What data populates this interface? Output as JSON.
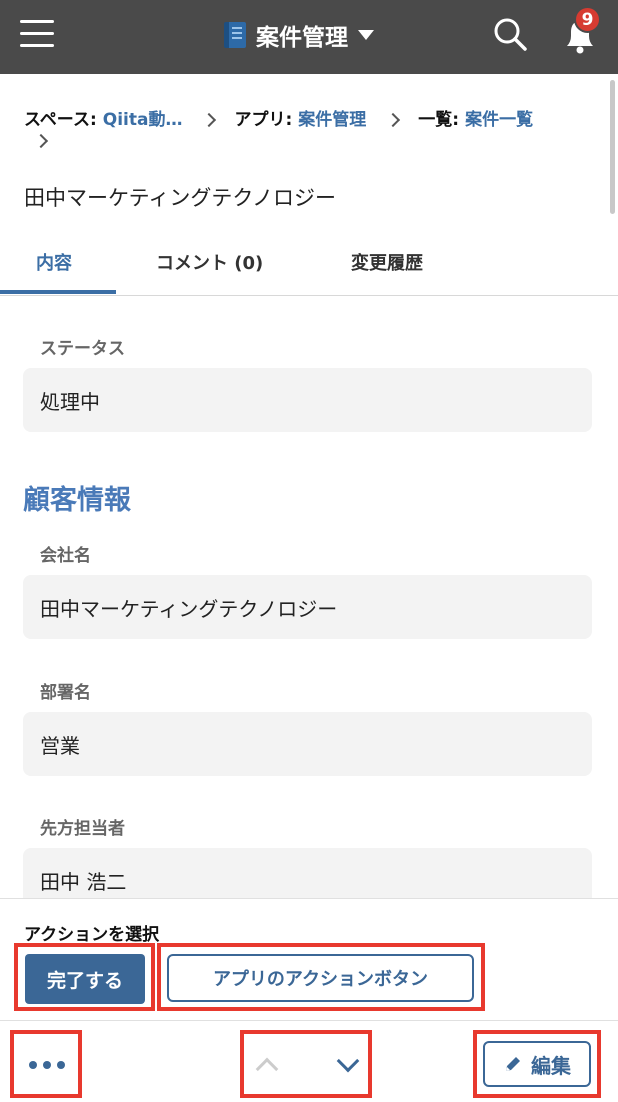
{
  "header": {
    "app_title": "案件管理",
    "notification_count": "9"
  },
  "breadcrumb": {
    "space_label": "スペース:",
    "space_value": "Qiita動…",
    "app_label": "アプリ:",
    "app_value": "案件管理",
    "list_label": "一覧:",
    "list_value": "案件一覧"
  },
  "record": {
    "title": "田中マーケティングテクノロジー"
  },
  "tabs": [
    {
      "label": "内容",
      "active": true
    },
    {
      "label": "コメント (0)",
      "active": false
    },
    {
      "label": "変更履歴",
      "active": false
    }
  ],
  "fields": {
    "status": {
      "label": "ステータス",
      "value": "処理中"
    },
    "section_customer": "顧客情報",
    "company": {
      "label": "会社名",
      "value": "田中マーケティングテクノロジー"
    },
    "department": {
      "label": "部署名",
      "value": "営業"
    },
    "contact": {
      "label": "先方担当者",
      "value": "田中 浩二"
    }
  },
  "actions": {
    "title": "アクションを選択",
    "complete_label": "完了する",
    "app_action_label": "アプリのアクションボタン"
  },
  "footer": {
    "edit_label": "編集",
    "icons": [
      "more-icon",
      "chevron-up-icon",
      "chevron-down-icon",
      "pencil-icon"
    ]
  },
  "colors": {
    "topbar": "#4a4a4a",
    "accent": "#3b6ea5",
    "section_heading": "#4a7ab8",
    "highlight": "#e8392e",
    "badge": "#d63b31"
  }
}
